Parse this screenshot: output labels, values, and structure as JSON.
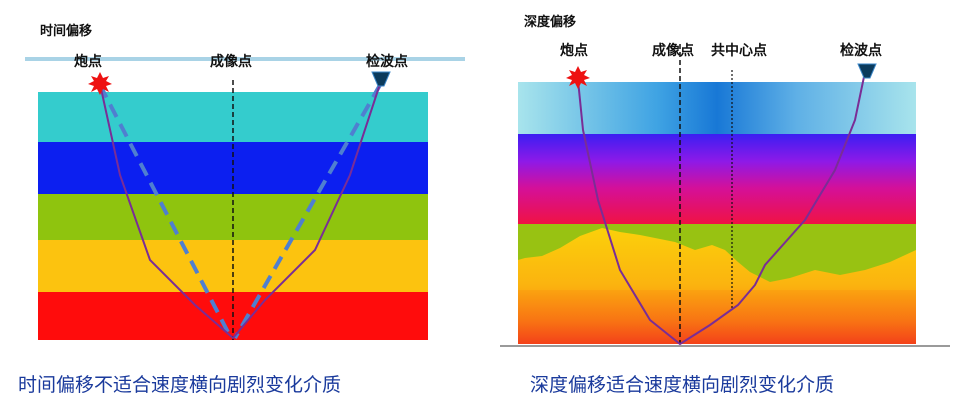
{
  "left": {
    "title": "时间偏移",
    "source_label": "炮点",
    "image_point_label": "成像点",
    "receiver_label": "检波点",
    "caption": "时间偏移不适合速度横向剧烈变化介质",
    "layer_colors": [
      "#34cccd",
      "#0c1ff0",
      "#8fc40e",
      "#fcc30f",
      "#ff0c0c"
    ],
    "ray_color": "#7a2d96",
    "dash_color": "#4f7fd0"
  },
  "right": {
    "title": "深度偏移",
    "source_label": "炮点",
    "image_point_label": "成像点",
    "cmp_label": "共中心点",
    "receiver_label": "检波点",
    "caption": "深度偏移适合速度横向剧烈变化介质",
    "ray_color": "#7a2d96"
  }
}
